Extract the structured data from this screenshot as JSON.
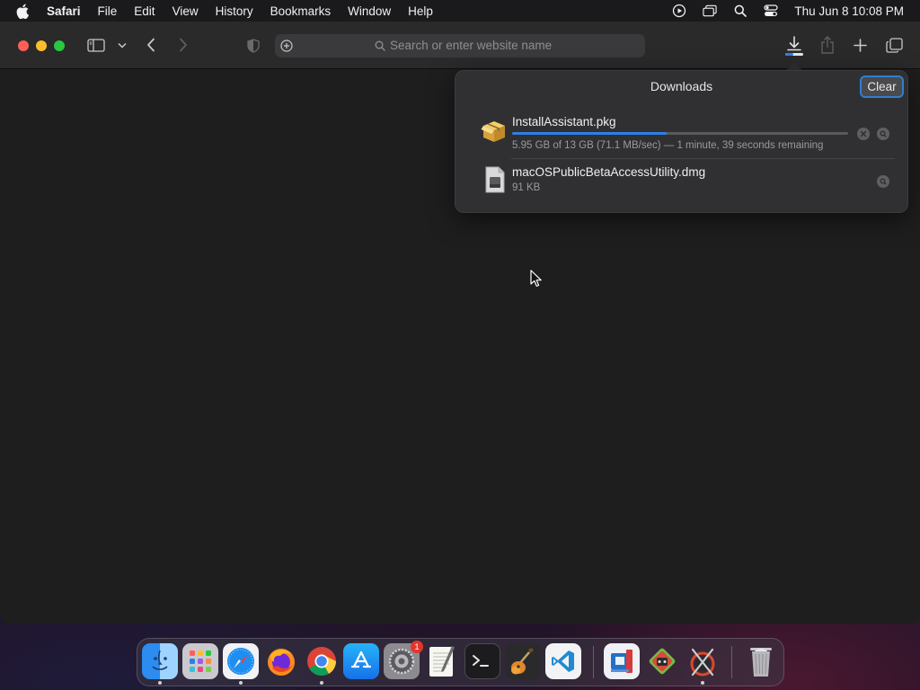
{
  "menubar": {
    "app_name": "Safari",
    "items": [
      "File",
      "Edit",
      "View",
      "History",
      "Bookmarks",
      "Window",
      "Help"
    ],
    "clock": "Thu Jun 8  10:08 PM"
  },
  "toolbar": {
    "address_placeholder": "Search or enter website name"
  },
  "downloads": {
    "title": "Downloads",
    "clear_label": "Clear",
    "items": [
      {
        "name": "InstallAssistant.pkg",
        "status": "5.95 GB of 13 GB (71.1 MB/sec) — 1 minute, 39 seconds remaining",
        "progress": 0.46,
        "icon": "package-icon"
      },
      {
        "name": "macOSPublicBetaAccessUtility.dmg",
        "status": "91 KB",
        "icon": "disk-image-icon"
      }
    ]
  },
  "dock": {
    "apps": [
      "Finder",
      "Launchpad",
      "Safari",
      "Firefox",
      "Chrome",
      "App Store",
      "System Settings",
      "TextEdit",
      "Terminal",
      "GarageBand",
      "Visual Studio Code",
      "Remote Desktop",
      "Game",
      "Xcode Instruments",
      "Trash"
    ],
    "settings_badge": "1"
  },
  "colors": {
    "accent": "#2f7fe6",
    "close": "#ff5f57",
    "minimize": "#febc2e",
    "zoom": "#28c840"
  }
}
